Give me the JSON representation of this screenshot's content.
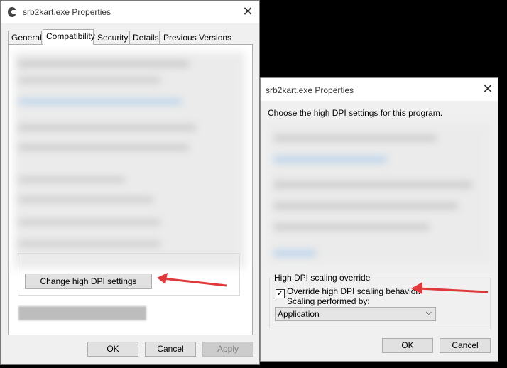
{
  "dialog1": {
    "title": "srb2kart.exe Properties",
    "close_glyph": "✕",
    "tabs": [
      "General",
      "Compatibility",
      "Security",
      "Details",
      "Previous Versions"
    ],
    "active_tab": "Compatibility",
    "change_dpi_button": "Change high DPI settings",
    "buttons": {
      "ok": "OK",
      "cancel": "Cancel",
      "apply": "Apply"
    }
  },
  "dialog2": {
    "title": "srb2kart.exe Properties",
    "close_glyph": "✕",
    "intro": "Choose the high DPI settings for this program.",
    "group_title": "High DPI scaling override",
    "checkbox_label": "Override high DPI scaling behavior.",
    "checkbox_checked": true,
    "check_glyph": "✓",
    "scaling_label": "Scaling performed by:",
    "scaling_value": "Application",
    "chevron_glyph": "⌵",
    "buttons": {
      "ok": "OK",
      "cancel": "Cancel"
    }
  },
  "colors": {
    "annotation_arrow": "#e0393b"
  },
  "icons": [
    "app-icon",
    "close-icon",
    "chevron-down-icon",
    "check-icon",
    "annotation-arrow-icon"
  ]
}
